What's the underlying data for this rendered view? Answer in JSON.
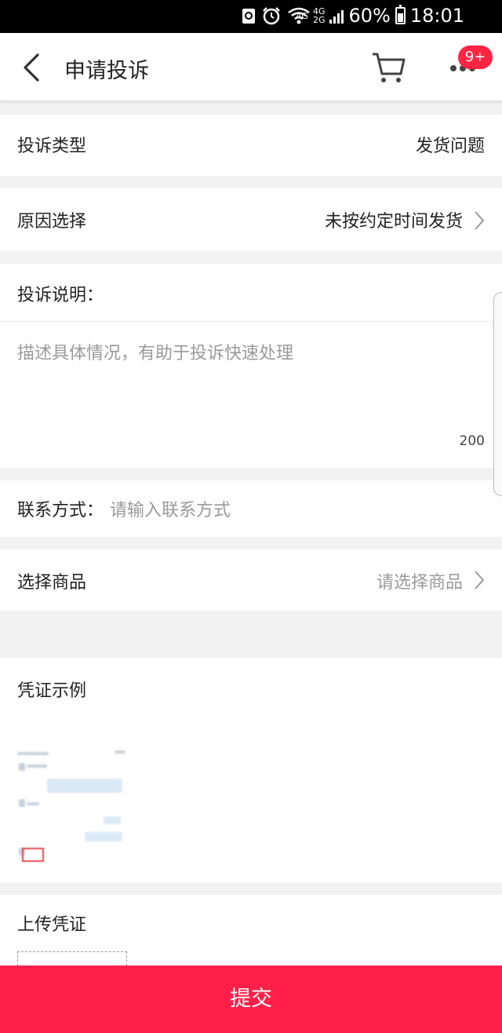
{
  "status_bar": {
    "network_top": "4G",
    "network_mid_top": "4G",
    "network_mid_bottom": "2G",
    "battery_percent": "60%",
    "time": "18:01"
  },
  "header": {
    "title": "申请投诉",
    "badge": "9+"
  },
  "form": {
    "complaint_type_label": "投诉类型",
    "complaint_type_value": "发货问题",
    "reason_label": "原因选择",
    "reason_value": "未按约定时间发货",
    "description_label": "投诉说明：",
    "description_placeholder": "描述具体情况，有助于投诉快速处理",
    "char_limit": "200",
    "contact_label": "联系方式：",
    "contact_placeholder": "请输入联系方式",
    "product_label": "选择商品",
    "product_placeholder": "请选择商品"
  },
  "proof": {
    "example_label": "凭证示例",
    "upload_label": "上传凭证"
  },
  "submit_label": "提交"
}
